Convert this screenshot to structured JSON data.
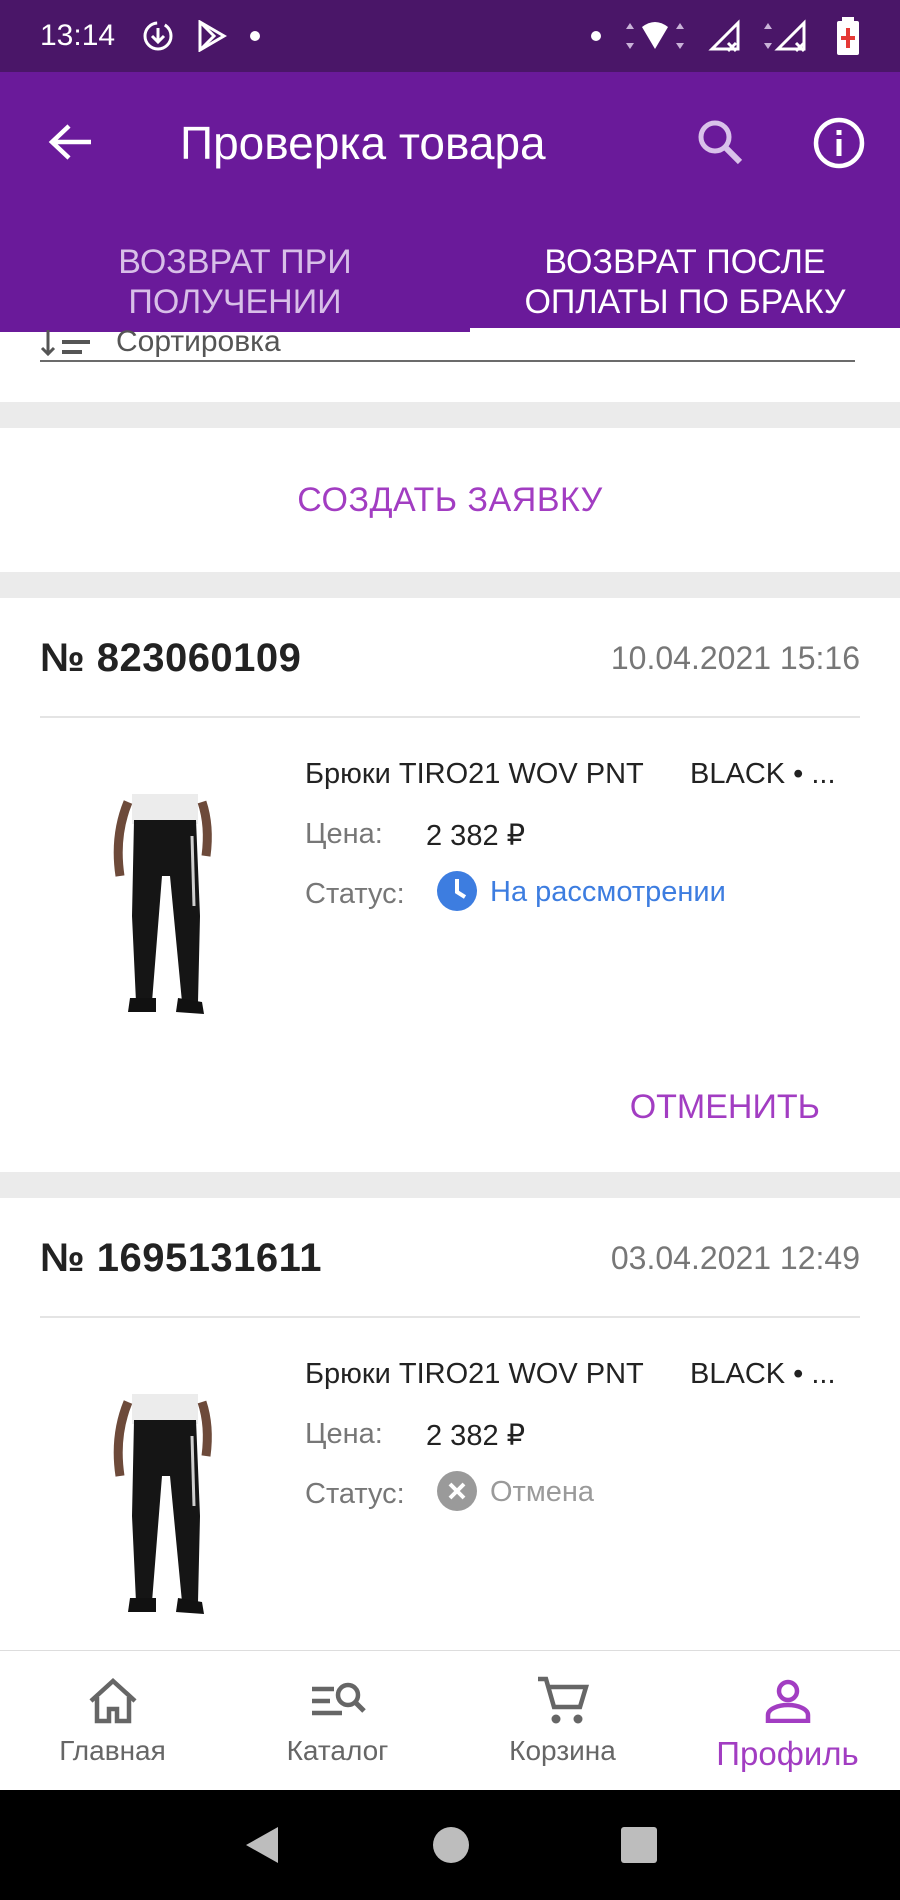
{
  "status_bar": {
    "time": "13:14"
  },
  "app_bar": {
    "title": "Проверка товара"
  },
  "tabs": [
    {
      "label": "ВОЗВРАТ ПРИ ПОЛУЧЕНИИ",
      "active": false
    },
    {
      "label": "ВОЗВРАТ ПОСЛЕ ОПЛАТЫ ПО БРАКУ",
      "active": true
    }
  ],
  "sort": {
    "label": "Сортировка"
  },
  "create_button": "СОЗДАТЬ ЗАЯВКУ",
  "labels": {
    "price": "Цена:",
    "status": "Статус:"
  },
  "orders": [
    {
      "number": "№ 823060109",
      "date": "10.04.2021 15:16",
      "product_name": "Брюки TIRO21 WOV PNT",
      "product_color": "BLACK • ...",
      "price": "2 382 ₽",
      "status": "На рассмотрении",
      "status_color": "#3d7de0",
      "action": "ОТМЕНИТЬ"
    },
    {
      "number": "№ 1695131611",
      "date": "03.04.2021 12:49",
      "product_name": "Брюки TIRO21 WOV PNT",
      "product_color": "BLACK • ...",
      "price": "2 382 ₽",
      "status": "Отмена",
      "status_color": "#9a9a9a"
    }
  ],
  "bottom_nav": [
    {
      "label": "Главная",
      "icon": "home-icon"
    },
    {
      "label": "Каталог",
      "icon": "catalog-search-icon"
    },
    {
      "label": "Корзина",
      "icon": "cart-icon"
    },
    {
      "label": "Профиль",
      "icon": "profile-icon",
      "active": true
    }
  ],
  "colors": {
    "primary": "#6a1a9a",
    "status_bar": "#4a1668",
    "accent": "#a23dc2"
  }
}
